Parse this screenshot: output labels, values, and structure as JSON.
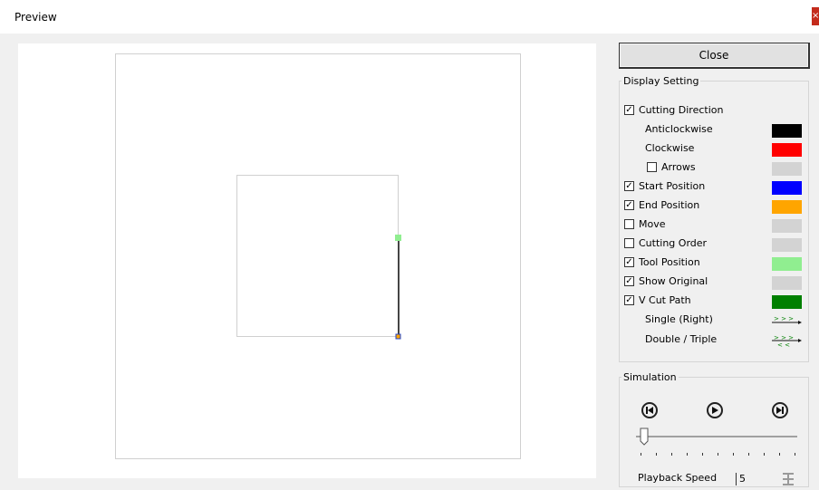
{
  "window": {
    "title": "Preview",
    "close_glyph": "×"
  },
  "close_button": {
    "label": "Close"
  },
  "display_setting": {
    "legend": "Display Setting",
    "items": [
      {
        "label": "Cutting Direction",
        "checkbox": true,
        "checked": true,
        "color": ""
      },
      {
        "label": "Anticlockwise",
        "checkbox": false,
        "color": "#000000"
      },
      {
        "label": "Clockwise",
        "checkbox": false,
        "color": "#ff0000"
      },
      {
        "label": "Arrows",
        "checkbox": true,
        "checked": false,
        "color": "#d3d3d3"
      },
      {
        "label": "Start Position",
        "checkbox": true,
        "checked": true,
        "color": "#0000ff"
      },
      {
        "label": "End Position",
        "checkbox": true,
        "checked": true,
        "color": "#ffa500"
      },
      {
        "label": "Move",
        "checkbox": true,
        "checked": false,
        "color": "#d3d3d3"
      },
      {
        "label": "Cutting Order",
        "checkbox": true,
        "checked": false,
        "color": "#d3d3d3"
      },
      {
        "label": "Tool Position",
        "checkbox": true,
        "checked": true,
        "color": "#90ee90"
      },
      {
        "label": "Show Original",
        "checkbox": true,
        "checked": true,
        "color": "#d3d3d3"
      },
      {
        "label": "V Cut Path",
        "checkbox": true,
        "checked": true,
        "color": "#008000"
      },
      {
        "label": "Single (Right)",
        "checkbox": false,
        "color": ""
      },
      {
        "label": "Double / Triple",
        "checkbox": false,
        "color": ""
      }
    ]
  },
  "simulation": {
    "legend": "Simulation",
    "buttons": [
      "skip-to-start-icon",
      "play-icon",
      "skip-to-end-icon"
    ],
    "playback_label": "Playback Speed",
    "playback_value": "5",
    "slider_value_fraction": 0.05
  }
}
